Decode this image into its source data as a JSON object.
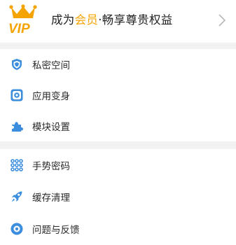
{
  "vip": {
    "badge_text": "VIP",
    "title_prefix": "成为",
    "title_highlight": "会员",
    "title_suffix": "·畅享尊贵权益",
    "accent_color": "#f5a300"
  },
  "menu_group_1": [
    {
      "label": "私密空间",
      "icon": "shield-icon"
    },
    {
      "label": "应用变身",
      "icon": "app-disguise-icon"
    },
    {
      "label": "模块设置",
      "icon": "puzzle-icon"
    }
  ],
  "menu_group_2": [
    {
      "label": "手势密码",
      "icon": "gesture-grid-icon"
    },
    {
      "label": "缓存清理",
      "icon": "rocket-icon"
    },
    {
      "label": "问题与反馈",
      "icon": "feedback-icon"
    }
  ],
  "icon_color": "#3b8ede"
}
